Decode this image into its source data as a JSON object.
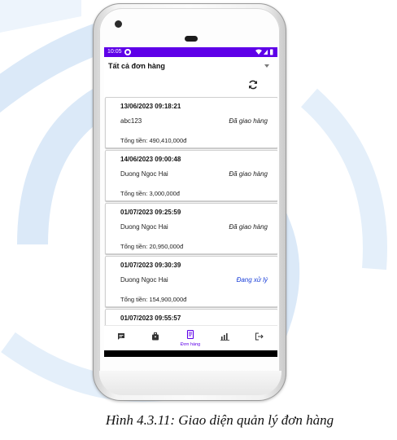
{
  "status_bar": {
    "time": "10:05"
  },
  "filter": {
    "selected": "Tất cả đơn hàng"
  },
  "orders": [
    {
      "date": "13/06/2023 09:18:21",
      "customer": "abc123",
      "status": "Đã giao hàng",
      "total": "Tổng tiền: 490,410,000đ"
    },
    {
      "date": "14/06/2023 09:00:48",
      "customer": "Duong Ngoc Hai",
      "status": "Đã giao hàng",
      "total": "Tổng tiền: 3,000,000đ"
    },
    {
      "date": "01/07/2023 09:25:59",
      "customer": "Duong Ngoc Hai",
      "status": "Đã giao hàng",
      "total": "Tổng tiền: 20,950,000đ"
    },
    {
      "date": "01/07/2023 09:30:39",
      "customer": "Duong Ngoc Hai",
      "status": "Đang xử lý",
      "total": "Tổng tiền: 154,900,000đ"
    },
    {
      "date": "01/07/2023 09:55:57"
    }
  ],
  "nav": {
    "items": [
      {
        "icon": "message-icon"
      },
      {
        "icon": "product-box-icon"
      },
      {
        "icon": "orders-icon",
        "label": "Đơn hàng"
      },
      {
        "icon": "statistics-icon"
      },
      {
        "icon": "logout-icon"
      }
    ]
  },
  "caption": "Hình 4.3.11: Giao diện quản lý đơn hàng",
  "colors": {
    "primary": "#5e00e8",
    "processing": "#1a3fd8",
    "background_logo": "#d6e6f7"
  }
}
